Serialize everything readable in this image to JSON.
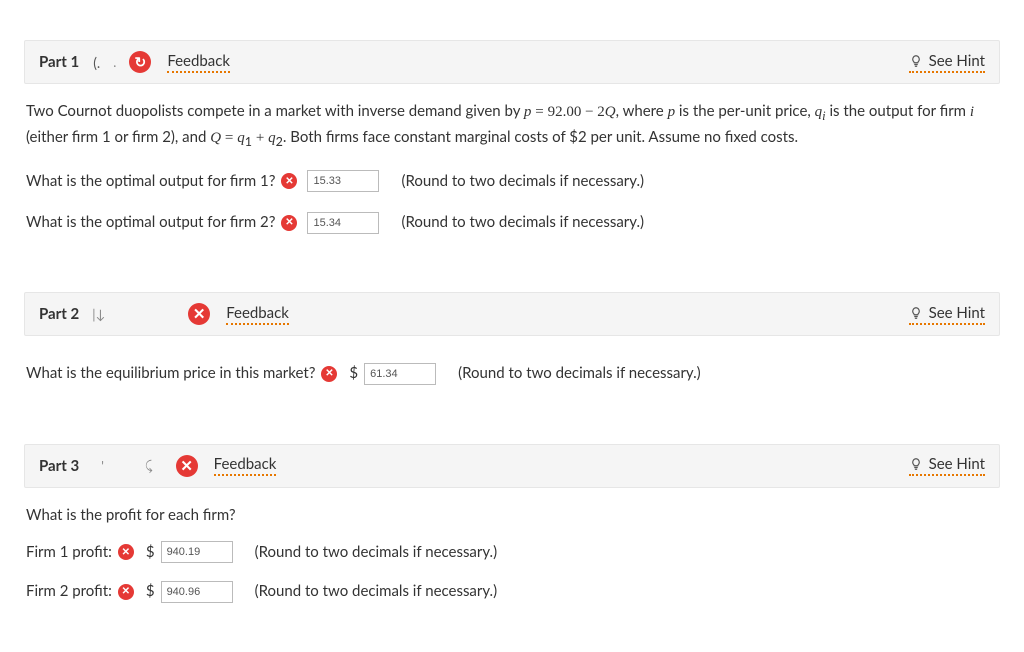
{
  "labels": {
    "feedback": "Feedback",
    "see_hint": "See Hint",
    "round_hint": "(Round to two decimals if necessary.)"
  },
  "part1": {
    "title": "Part 1",
    "subtitle": "(.",
    "prompt_html": "Two Cournot duopolists compete in a market with inverse demand given by <span class='math ital'>p</span> <span class='math'>=</span> <span class='math'>92.00 − 2</span><span class='math ital'>Q</span>, where <span class='math ital'>p</span> is the per-unit price, <span class='math ital'>q<sub>i</sub></span> is the output for firm <span class='math ital'>i</span> (either firm 1 or firm 2), and <span class='math ital'>Q</span> <span class='math'>=</span> <span class='math ital'>q</span><sub>1</sub> <span class='math'>+</span> <span class='math ital'>q</span><sub>2</sub>. Both firms face constant marginal costs of $2 per unit. Assume no fixed costs.",
    "q1_label": "What is the optimal output for firm 1?",
    "q1_value": "15.33",
    "q2_label": "What is the optimal output for firm 2?",
    "q2_value": "15.34"
  },
  "part2": {
    "title": "Part 2",
    "subtitle": "",
    "q_label": "What is the equilibrium price in this market?",
    "q_value": "61.34"
  },
  "part3": {
    "title": "Part 3",
    "subtitle": "",
    "intro": "What is the profit for each firm?",
    "f1_label": "Firm 1 profit:",
    "f1_value": "940.19",
    "f2_label": "Firm 2 profit:",
    "f2_value": "940.96"
  }
}
